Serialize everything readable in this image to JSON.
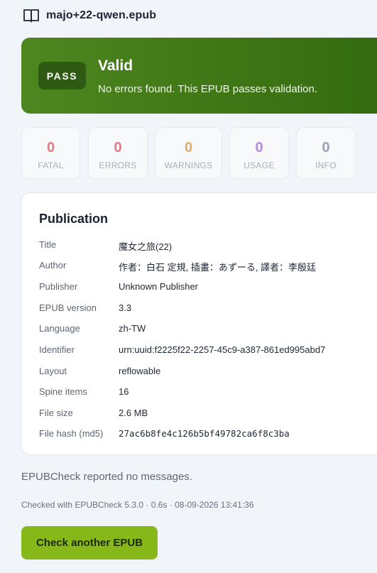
{
  "header": {
    "icon": "book-icon",
    "file_name": "majo+22-qwen.epub"
  },
  "banner": {
    "badge": "PASS",
    "title": "Valid",
    "message": "No errors found. This EPUB passes validation.",
    "colors": {
      "start": "#4e8620",
      "end": "#336a10",
      "badge_bg": "#2f5a14"
    }
  },
  "stats": [
    {
      "value": "0",
      "label": "FATAL",
      "color": "#e07b87"
    },
    {
      "value": "0",
      "label": "ERRORS",
      "color": "#e07b87"
    },
    {
      "value": "0",
      "label": "WARNINGS",
      "color": "#e0ad6b"
    },
    {
      "value": "0",
      "label": "USAGE",
      "color": "#b487e6"
    },
    {
      "value": "0",
      "label": "INFO",
      "color": "#9aa3b0"
    }
  ],
  "publication": {
    "heading": "Publication",
    "rows": [
      {
        "key": "Title",
        "value": "魔女之旅(22)"
      },
      {
        "key": "Author",
        "value": "作者：白石 定規, 插畫：あずーる, 譯者：李殷廷"
      },
      {
        "key": "Publisher",
        "value": "Unknown Publisher"
      },
      {
        "key": "EPUB version",
        "value": "3.3"
      },
      {
        "key": "Language",
        "value": "zh-TW"
      },
      {
        "key": "Identifier",
        "value": "urn:uuid:f2225f22-2257-45c9-a387-861ed995abd7"
      },
      {
        "key": "Layout",
        "value": "reflowable"
      },
      {
        "key": "Spine items",
        "value": "16"
      },
      {
        "key": "File size",
        "value": "2.6 MB"
      },
      {
        "key": "File hash (md5)",
        "value": "27ac6b8fe4c126b5bf49782ca6f8c3ba"
      }
    ]
  },
  "no_messages": "EPUBCheck reported no messages.",
  "checked_with": "Checked with EPUBCheck 5.3.0 · 0.6s · 08-09-2026 13:41:36",
  "action": {
    "label": "Check another EPUB",
    "color": "#86b81a"
  }
}
